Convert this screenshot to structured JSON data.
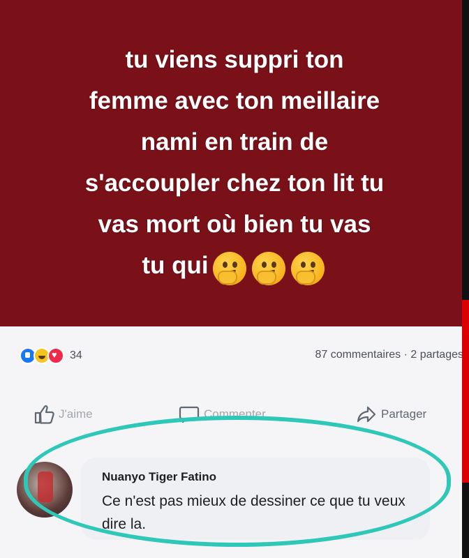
{
  "post": {
    "text_line_1": "tu viens suppri ton",
    "text_line_2": "femme avec ton meillaire",
    "text_line_3": "nami en train de",
    "text_line_4": "s'accoupler chez ton lit tu",
    "text_line_5": "vas mort où bien tu vas",
    "text_line_6": "tu qui",
    "emoji": [
      "thinking-face",
      "thinking-face",
      "thinking-face"
    ],
    "background_color": "#7a1018"
  },
  "stats": {
    "reaction_icons": [
      "like",
      "haha",
      "love"
    ],
    "reaction_count": "34",
    "comments_shares": "87 commentaires · 2 partages"
  },
  "actions": {
    "like_label": "J'aime",
    "comment_label": "Commenter",
    "share_label": "Partager"
  },
  "comment": {
    "author": "Nuanyo Tiger Fatino",
    "text": "Ce n'est pas mieux de dessiner ce que tu veux dire la."
  },
  "colors": {
    "highlight": "#2ec7b8",
    "accent_blue": "#1877f2"
  }
}
